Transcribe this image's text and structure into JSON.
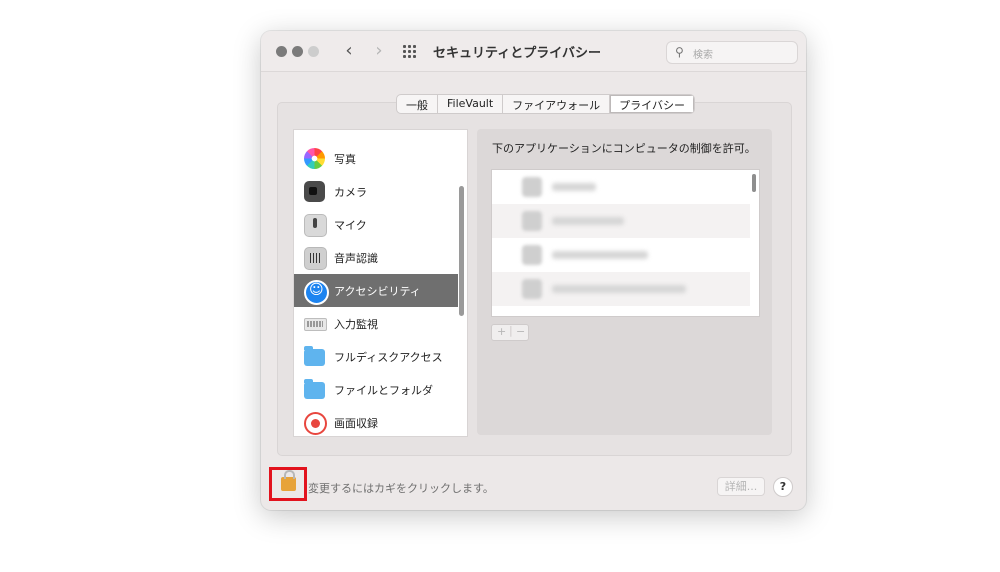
{
  "window": {
    "title": "セキュリティとプライバシー"
  },
  "nav": {
    "back": "‹",
    "forward": "›"
  },
  "search": {
    "placeholder": "検索",
    "icon": "search-icon"
  },
  "tabs": [
    {
      "label": "一般"
    },
    {
      "label": "FileVault"
    },
    {
      "label": "ファイアウォール"
    },
    {
      "label": "プライバシー",
      "selected": true
    }
  ],
  "sidebar": {
    "items": [
      {
        "label": "写真",
        "icon": "photos-icon"
      },
      {
        "label": "カメラ",
        "icon": "camera-icon"
      },
      {
        "label": "マイク",
        "icon": "microphone-icon"
      },
      {
        "label": "音声認識",
        "icon": "speech-recognition-icon"
      },
      {
        "label": "アクセシビリティ",
        "icon": "accessibility-icon",
        "selected": true
      },
      {
        "label": "入力監視",
        "icon": "keyboard-icon"
      },
      {
        "label": "フルディスクアクセス",
        "icon": "folder-icon"
      },
      {
        "label": "ファイルとフォルダ",
        "icon": "folder-icon"
      },
      {
        "label": "画面収録",
        "icon": "screen-recording-icon"
      }
    ]
  },
  "main": {
    "heading": "下のアプリケーションにコンピュータの制御を許可。",
    "add_label": "+",
    "remove_label": "−"
  },
  "footer": {
    "lock_text": "変更するにはカギをクリックします。",
    "details_label": "詳細...",
    "help_label": "?"
  },
  "colors": {
    "highlight": "#e2121d",
    "selected_row": "#6f6f6f"
  }
}
